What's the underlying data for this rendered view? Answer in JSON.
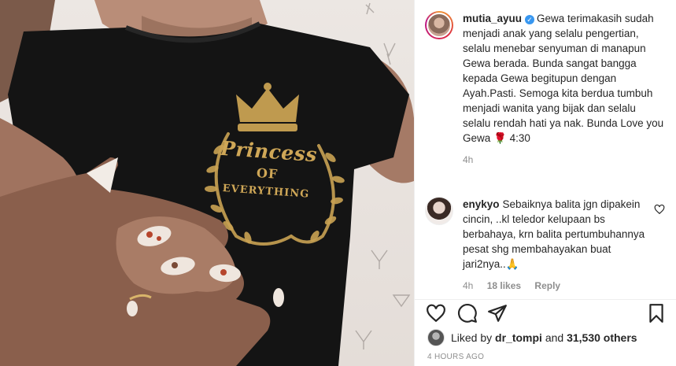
{
  "post": {
    "shirt_line1": "Princess",
    "shirt_line2": "OF",
    "shirt_line3": "EVERYTHING"
  },
  "caption": {
    "username": "mutia_ayuu",
    "verified_icon": "verified-badge-icon",
    "text": "Gewa terimakasih sudah menjadi anak yang selalu pengertian, selalu menebar senyuman di manapun Gewa berada. Bunda sangat bangga kepada Gewa begitupun dengan Ayah.Pasti. Semoga kita berdua tumbuh menjadi wanita yang bijak dan selalu selalu rendah hati ya nak. Bunda Love you Gewa 🌹 4:30",
    "time": "4h"
  },
  "comments": [
    {
      "username": "enykyo",
      "text": "Sebaiknya balita jgn dipakein cincin, ..kl teledor kelupaan bs berbahaya, krn balita pertumbuhannya pesat shg membahayakan buat jari2nya..🙏",
      "time": "4h",
      "likes": "18 likes",
      "reply": "Reply"
    }
  ],
  "actions": {
    "like_icon": "heart-icon",
    "comment_icon": "comment-icon",
    "share_icon": "send-icon",
    "save_icon": "bookmark-icon"
  },
  "likes": {
    "prefix": "Liked by",
    "user": "dr_tompi",
    "conjunction": "and",
    "count": "31,530 others"
  },
  "timestamp": "4 HOURS AGO",
  "colors": {
    "verified": "#3897f0",
    "shirt_print": "#cfa757",
    "text_primary": "#262626",
    "text_secondary": "#8e8e8e"
  }
}
